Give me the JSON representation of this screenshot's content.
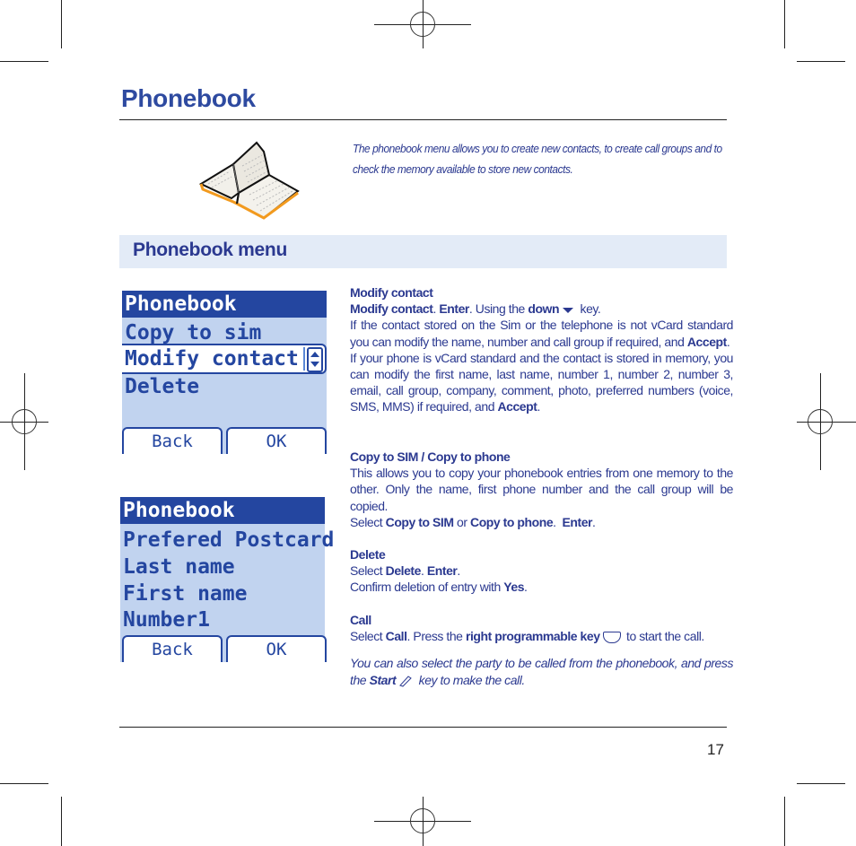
{
  "header": {
    "title": "Phonebook",
    "intro": "The phonebook menu allows you to create new contacts, to create call groups and to check the memory available to store new contacts."
  },
  "illustration": {
    "icon": "open-book-icon"
  },
  "section": {
    "title": "Phonebook menu"
  },
  "screen1": {
    "title": "Phonebook",
    "items": [
      "Copy to sim",
      "Modify contact",
      "Delete"
    ],
    "selected_index": 1,
    "softkeys": {
      "left": "Back",
      "right": "OK"
    }
  },
  "screen2": {
    "title": "Phonebook",
    "items": [
      "Prefered Postcard",
      "Last name",
      "First name",
      "Number1"
    ],
    "softkeys": {
      "left": "Back",
      "right": "OK"
    }
  },
  "content": {
    "modify": {
      "heading": "Modify contact",
      "l1_b1": "Modify contact",
      "l1_t1": ". ",
      "l1_b2": "Enter",
      "l1_t2": ".  Using the ",
      "l1_b3": "down",
      "l1_t3": " key.",
      "p1": "If the contact stored on the Sim or the telephone is not vCard standard you can modify the name, number and call group if required, and ",
      "p1_b": "Accept",
      "p2": "If your phone is vCard standard and the contact is stored in memory, you can modify the first name, last name, number 1, number 2, number 3, email, call group, company, comment, photo, preferred numbers (voice, SMS, MMS) if required, and ",
      "p2_b": "Accept"
    },
    "copy": {
      "heading": "Copy to SIM / Copy to phone",
      "p1": "This allows you to copy your phonebook entries from one memory to the other. Only the name, first phone number and the call group will be copied.",
      "sel_t1": "Select ",
      "sel_b1": "Copy to SIM",
      "sel_t2": " or ",
      "sel_b2": "Copy to phone",
      "sel_t3": ".  ",
      "sel_b3": "Enter"
    },
    "delete": {
      "heading": "Delete",
      "sel_t1": "Select ",
      "sel_b1": "Delete",
      "sel_t2": ". ",
      "sel_b2": "Enter",
      "confirm_t": "Confirm deletion of entry with ",
      "confirm_b": "Yes"
    },
    "call": {
      "heading": "Call",
      "t1": "Select ",
      "b1": "Call",
      "t2": ". Press the ",
      "b2": "right programmable key",
      "t3": " to start the call.",
      "italic_t1": "You can also select the party to be called from the phonebook, and press the ",
      "italic_b": "Start",
      "italic_t2": " key to make the call."
    }
  },
  "footer": {
    "page_number": "17"
  }
}
